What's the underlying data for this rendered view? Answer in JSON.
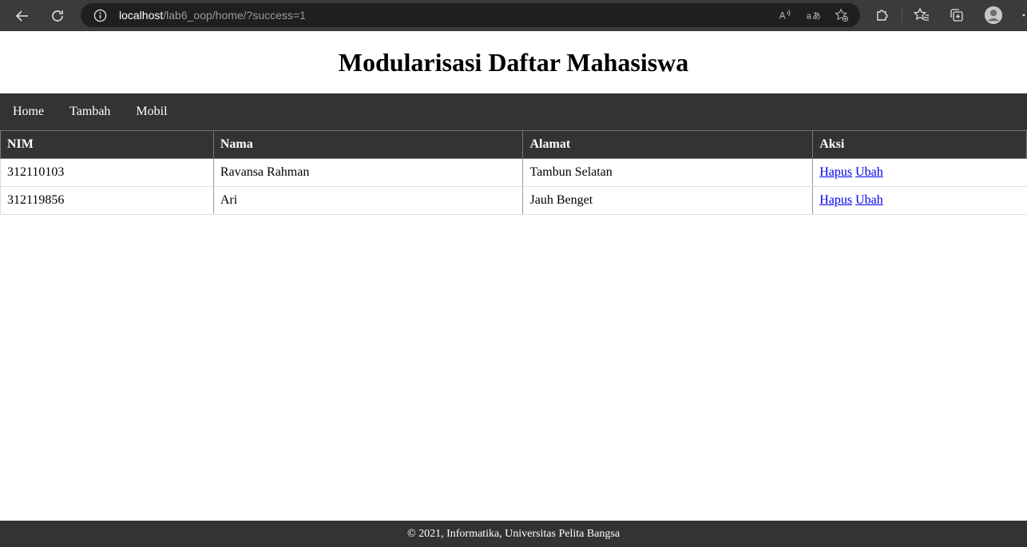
{
  "browser": {
    "url_host": "localhost",
    "url_path": "/lab6_oop/home/?success=1"
  },
  "page": {
    "title": "Modularisasi Daftar Mahasiswa"
  },
  "nav": {
    "items": [
      "Home",
      "Tambah",
      "Mobil"
    ]
  },
  "table": {
    "headers": [
      "NIM",
      "Nama",
      "Alamat",
      "Aksi"
    ],
    "rows": [
      {
        "nim": "312110103",
        "nama": "Ravansa Rahman",
        "alamat": "Tambun Selatan",
        "hapus": "Hapus",
        "ubah": "Ubah"
      },
      {
        "nim": "312119856",
        "nama": "Ari",
        "alamat": "Jauh Benget",
        "hapus": "Hapus",
        "ubah": "Ubah"
      }
    ]
  },
  "footer": {
    "text": "© 2021, Informatika, Universitas Pelita Bangsa"
  }
}
